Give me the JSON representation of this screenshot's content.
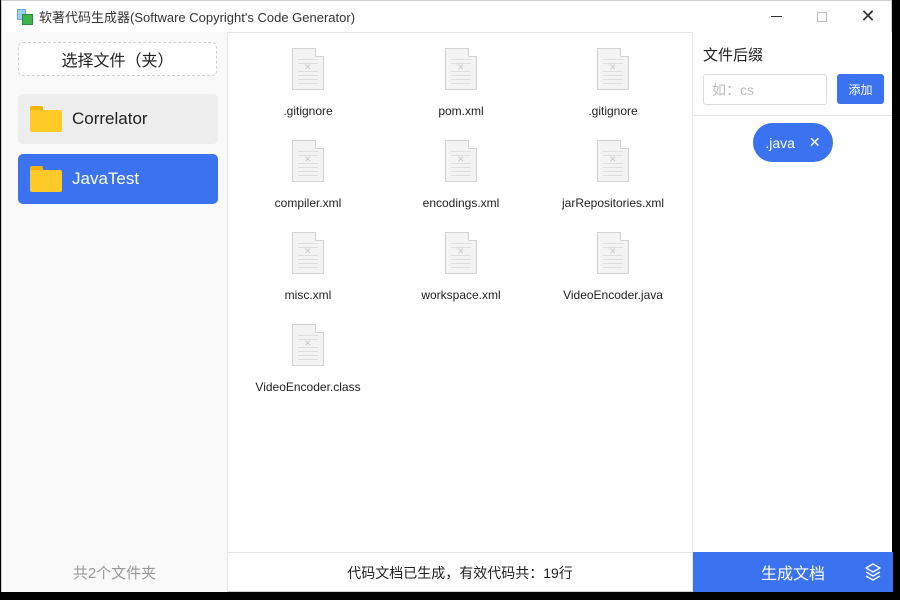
{
  "window": {
    "title": "软著代码生成器(Software Copyright's Code Generator)",
    "controls": [
      "minimize-icon",
      "maximize-icon",
      "close-icon"
    ],
    "close_glyph": "✕"
  },
  "sidebar": {
    "select_button": "选择文件（夹）",
    "folders": [
      {
        "label": "Correlator",
        "icon": "folder-icon",
        "selected": false
      },
      {
        "label": "JavaTest",
        "icon": "folder-icon",
        "selected": true
      }
    ],
    "footer": "共2个文件夹"
  },
  "files": [
    {
      "name": ".gitignore",
      "icon": "document-icon"
    },
    {
      "name": "pom.xml",
      "icon": "document-icon"
    },
    {
      "name": ".gitignore",
      "icon": "document-icon"
    },
    {
      "name": "compiler.xml",
      "icon": "document-icon"
    },
    {
      "name": "encodings.xml",
      "icon": "document-icon"
    },
    {
      "name": "jarRepositories.xml",
      "icon": "document-icon"
    },
    {
      "name": "misc.xml",
      "icon": "document-icon"
    },
    {
      "name": "workspace.xml",
      "icon": "document-icon"
    },
    {
      "name": "VideoEncoder.java",
      "icon": "document-icon"
    },
    {
      "name": "VideoEncoder.class",
      "icon": "document-icon"
    }
  ],
  "status": "代码文档已生成，有效代码共：19行",
  "right_panel": {
    "title": "文件后缀",
    "input": {
      "value": "",
      "placeholder": "如：cs"
    },
    "add_button": "添加",
    "tags": [
      {
        "label": ".java",
        "remove_glyph": "✕"
      }
    ],
    "generate_button": "生成文档",
    "generate_icon": "layers-icon"
  },
  "colors": {
    "accent": "#3b72f0",
    "folder": "#ffc928"
  }
}
